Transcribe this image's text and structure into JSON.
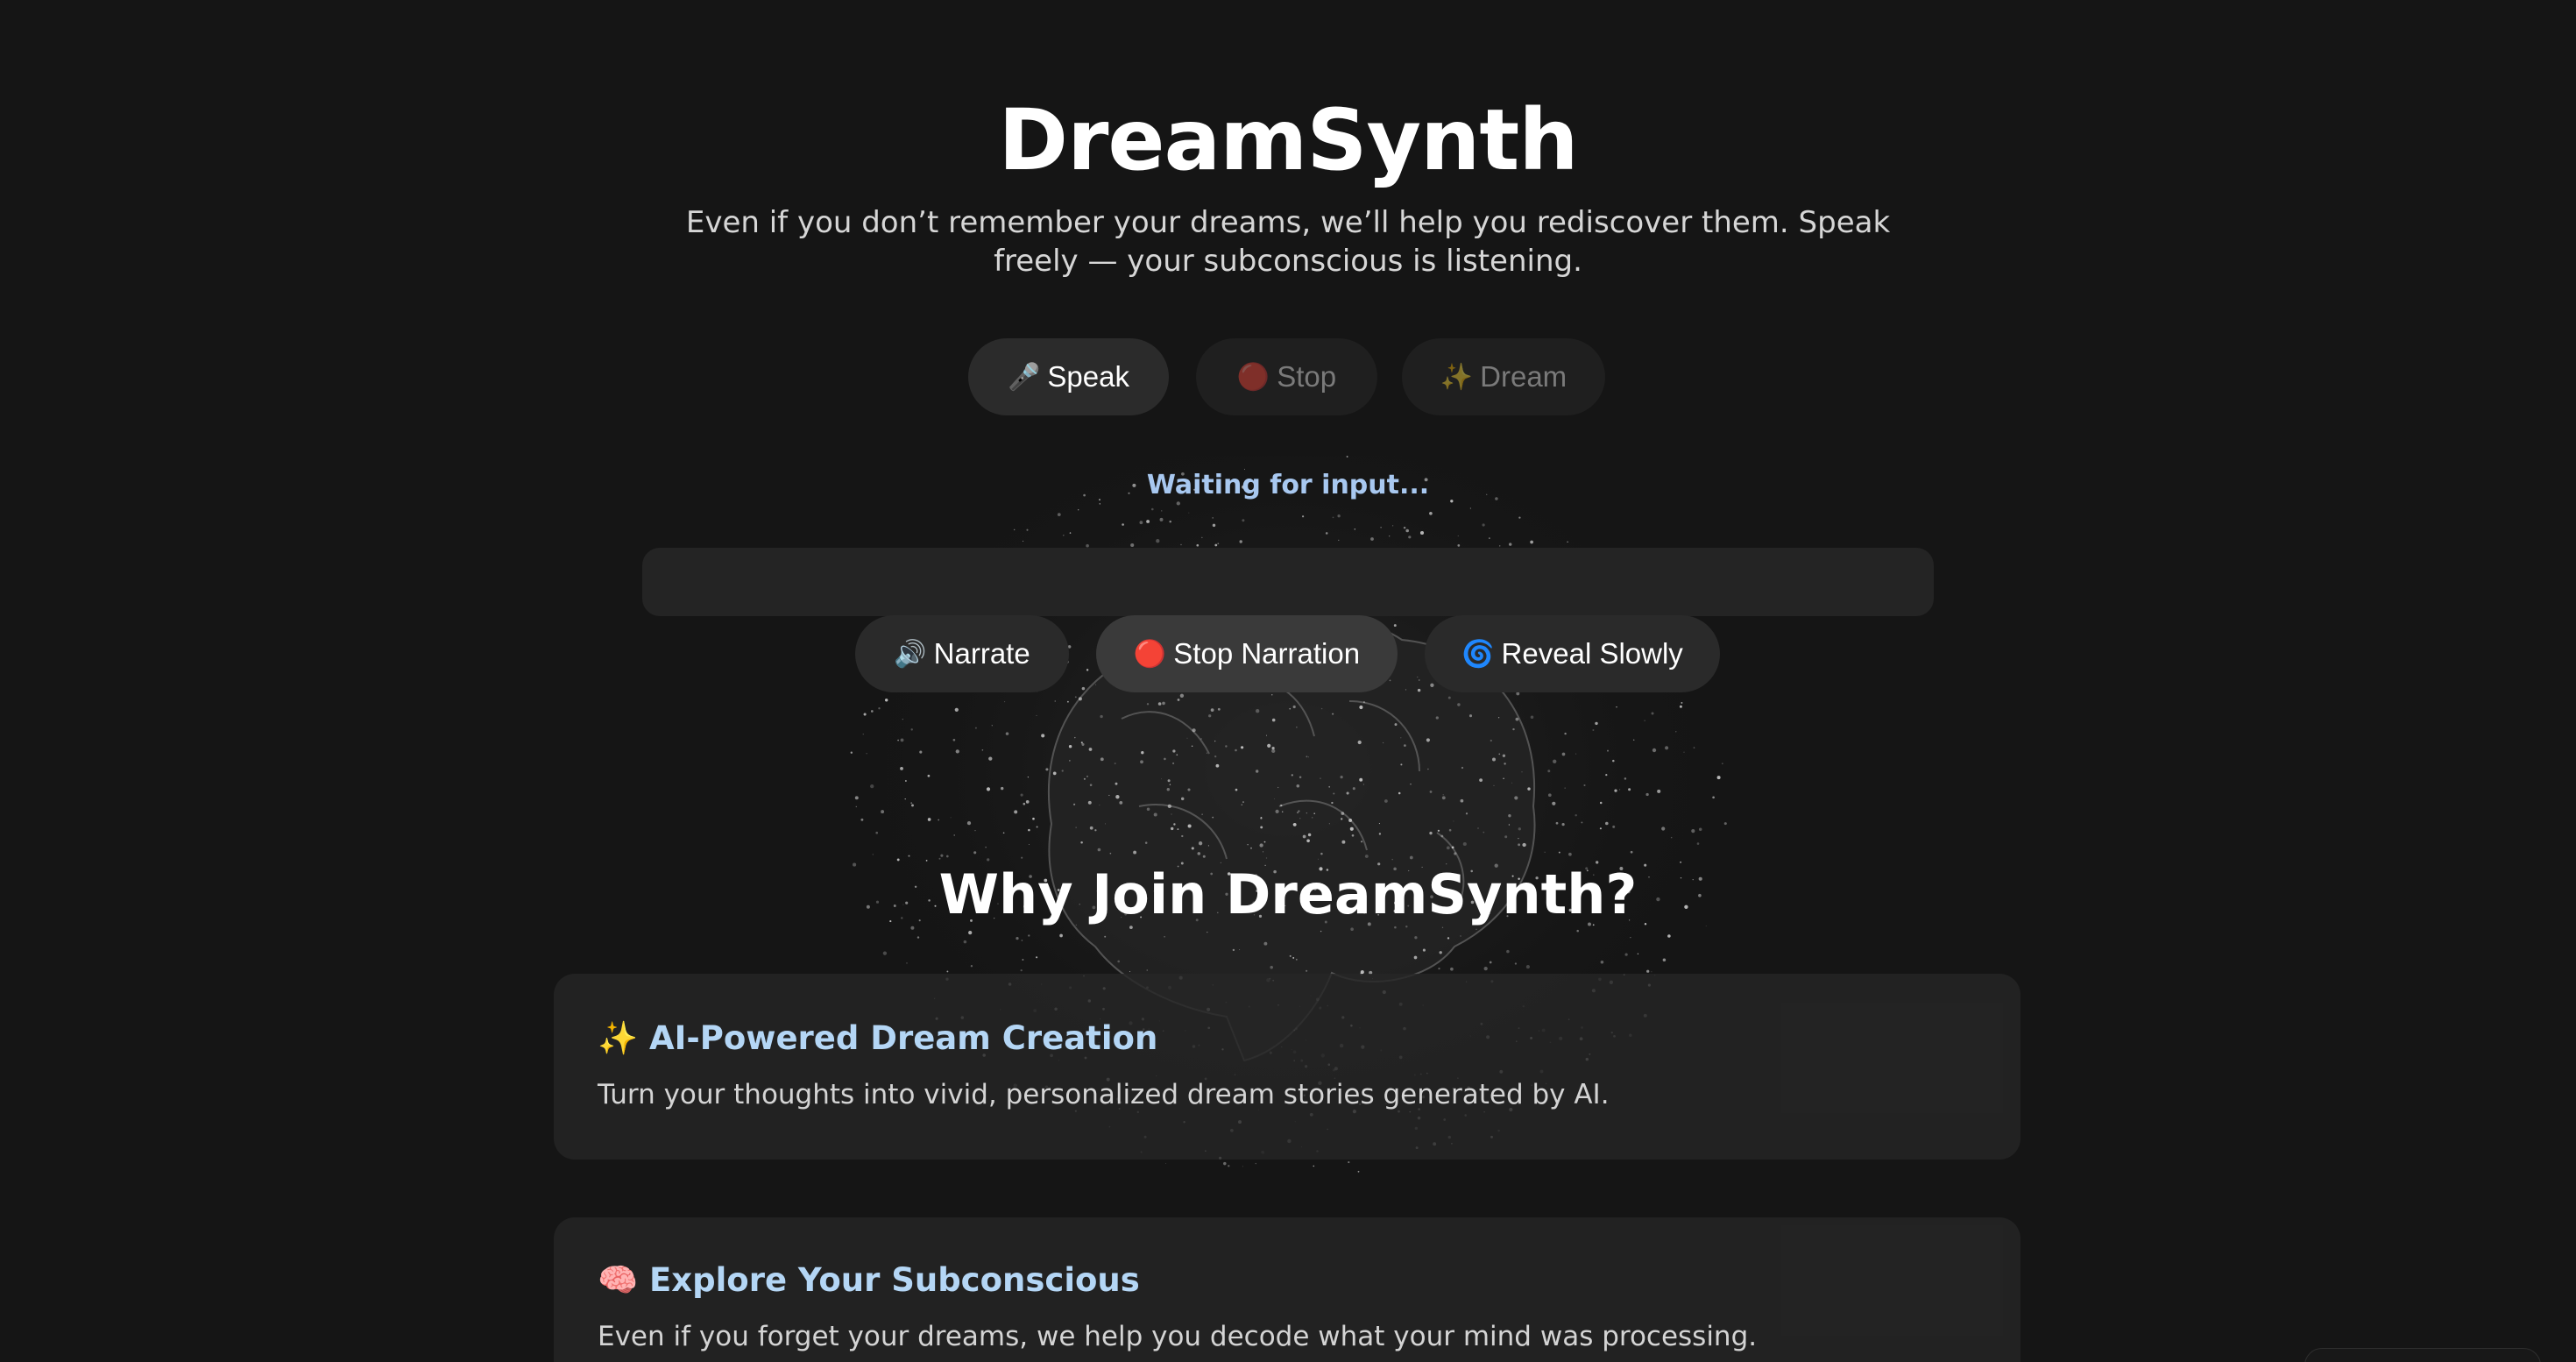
{
  "header": {
    "title": "DreamSynth",
    "subtitle": "Even if you don’t remember your dreams, we’ll help you rediscover them. Speak freely — your subconscious is listening."
  },
  "controls": {
    "speak": {
      "icon": "🎤",
      "label": "Speak"
    },
    "stop": {
      "icon": "🔴",
      "label": "Stop"
    },
    "dream": {
      "icon": "✨",
      "label": "Dream"
    }
  },
  "status": "Waiting for input...",
  "output": {
    "text": ""
  },
  "narration": {
    "narrate": {
      "icon": "🔊",
      "label": "Narrate"
    },
    "stop": {
      "icon": "🔴",
      "label": "Stop Narration"
    },
    "reveal": {
      "icon": "🌀",
      "label": "Reveal Slowly"
    }
  },
  "features": {
    "heading": "Why Join DreamSynth?",
    "items": [
      {
        "icon": "✨",
        "title": "AI-Powered Dream Creation",
        "description": "Turn your thoughts into vivid, personalized dream stories generated by AI."
      },
      {
        "icon": "🧠",
        "title": "Explore Your Subconscious",
        "description": "Even if you forget your dreams, we help you decode what your mind was processing."
      }
    ]
  },
  "colors": {
    "background": "#151515",
    "accent_text": "#b4d6f5",
    "status_text": "#a8c8f0"
  }
}
